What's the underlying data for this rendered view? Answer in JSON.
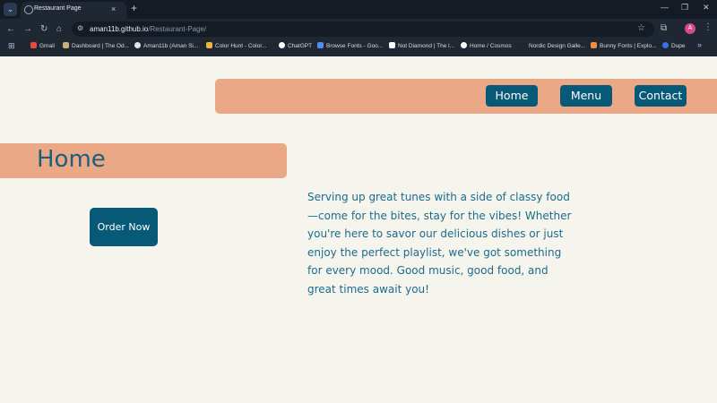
{
  "browser": {
    "tab_title": "Restaurant Page",
    "url_host": "aman11b.github.io",
    "url_path": "/Restaurant-Page/",
    "profile_initial": "A",
    "bookmarks": [
      "Gmail",
      "Dashboard | The Od...",
      "Aman11b (Aman Si...",
      "Color Hunt - Color...",
      "ChatGPT",
      "Browse Fonts - Goo...",
      "Not Diamond | The l...",
      "Home / Cosmos",
      "Nordic Design Galle...",
      "Bunny Fonts | Explo...",
      "Dupe"
    ]
  },
  "nav": {
    "home": "Home",
    "menu": "Menu",
    "contact": "Contact"
  },
  "main": {
    "heading": "Home",
    "order_button": "Order Now",
    "description": "Serving up great tunes with a side of classy food—come for the bites, stay for the vibes! Whether you're here to savor our delicious dishes or just enjoy the perfect playlist, we've got something for every mood. Good music, good food, and great times await you!"
  },
  "colors": {
    "accent_bar": "#eaa886",
    "button_bg": "#065a77",
    "page_bg": "#f5f5ee",
    "text": "#1d6a8c"
  }
}
